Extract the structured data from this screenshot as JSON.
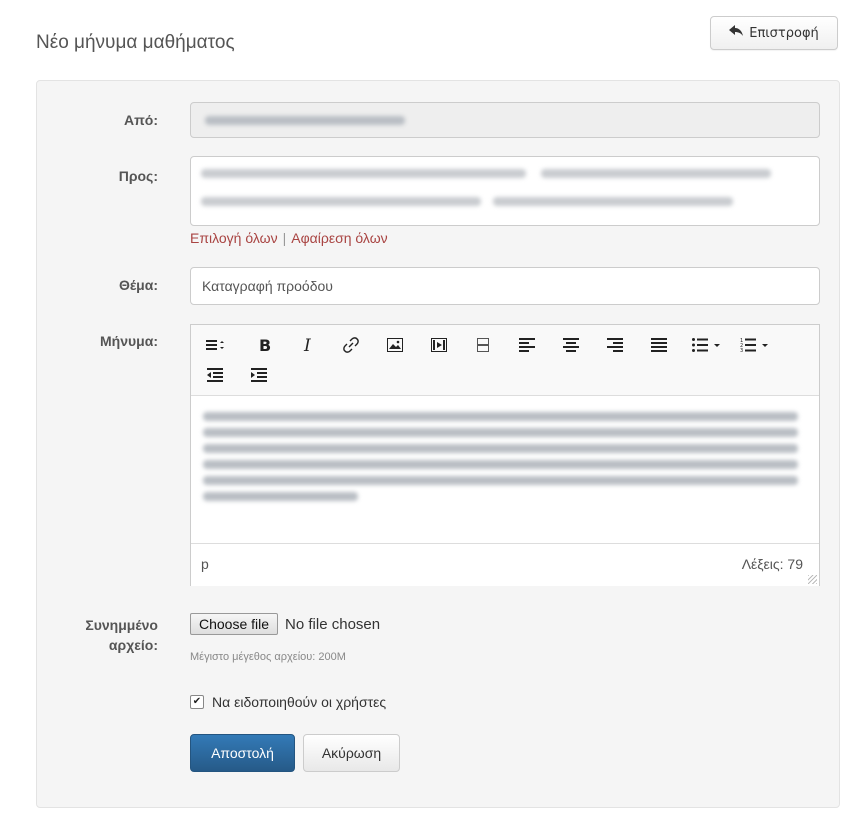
{
  "page": {
    "title": "Νέο μήνυμα μαθήματος",
    "back_label": "Επιστροφή"
  },
  "form": {
    "from_label": "Από:",
    "to_label": "Προς:",
    "select_all": "Επιλογή όλων",
    "separator": "|",
    "remove_all": "Αφαίρεση όλων",
    "subject_label": "Θέμα:",
    "subject_value": "Καταγραφή προόδου",
    "message_label": "Μήνυμα:",
    "attachment_label_line1": "Συνημμένο",
    "attachment_label_line2": "αρχείο:",
    "file_button": "Choose file",
    "file_status": "No file chosen",
    "max_size": "Μέγιστο μέγεθος αρχείου: 200M",
    "notify_label": "Να ειδοποιηθούν οι χρήστες",
    "notify_checked": true,
    "submit_label": "Αποστολή",
    "cancel_label": "Ακύρωση"
  },
  "editor": {
    "toolbar": [
      "format-icon",
      "bold-icon",
      "italic-icon",
      "link-icon",
      "image-icon",
      "media-icon",
      "page-break-icon",
      "align-left-icon",
      "align-center-icon",
      "align-right-icon",
      "align-justify-icon",
      "bullet-list-icon",
      "numbered-list-icon",
      "outdent-icon",
      "indent-icon"
    ],
    "status_path": "p",
    "word_count": "Λέξεις: 79"
  },
  "colors": {
    "link": "#a94442",
    "primary": "#337ab7",
    "panel_bg": "#f5f5f5"
  }
}
